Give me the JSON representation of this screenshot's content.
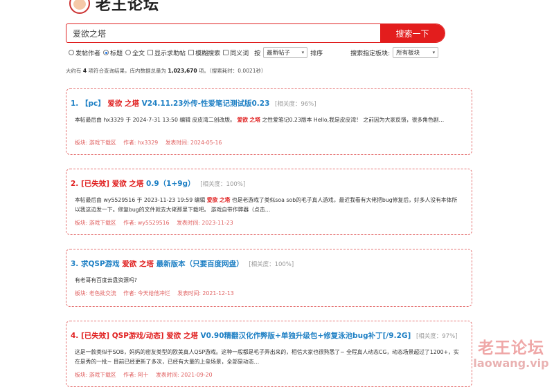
{
  "site": {
    "title": "老王论坛"
  },
  "search": {
    "query": "爱欲之塔",
    "button": "搜索一下"
  },
  "options": {
    "radios": [
      {
        "label": "发帖作者",
        "checked": false
      },
      {
        "label": "标题",
        "checked": true
      },
      {
        "label": "全文",
        "checked": false
      }
    ],
    "checks": [
      {
        "label": "显示求助帖"
      },
      {
        "label": "模糊搜索"
      },
      {
        "label": "同义词"
      }
    ],
    "sort_prefix": "按",
    "sort_value": "最新帖子",
    "sort_suffix": "排序",
    "board_label": "搜索指定板块:",
    "board_value": "所有板块"
  },
  "stats": {
    "p1": "大约有",
    "count": "4",
    "p2": "项符合查询结果，库内数据总量为",
    "total": "1,023,670",
    "p3": "项。（搜索耗时：0.0021秒）"
  },
  "results": [
    {
      "t1": "1. 【pc】",
      "h1": "爱欲",
      "h2": "之塔",
      "t2": "V24.11.23外传-性爱笔记测试版0.23",
      "rel": "[相关度：96%]",
      "d1": "本帖最后由 hx3329 于 2024-7-31 13:50 编辑 皮皮湾二创改版。",
      "dh1": "爱欲",
      "dh2": "之塔",
      "d2": "之性爱笔记0.23版本 Hello,我是皮皮湾！ 之前因为大家反馈，很多角色剧…",
      "board": "板块: 游戏下载区",
      "author": "作者: hx3329",
      "time": "发表时间: 2024-05-16"
    },
    {
      "t1": "2. [已失效]",
      "h1": "爱欲",
      "h2": "之塔",
      "t2": "0.9（1+9g）",
      "rel": "[相关度：100%]",
      "d1": "本帖最后由 wy5529516 于 2023-11-23 19:59 编辑",
      "dh1": "爱欲",
      "dh2": "之塔",
      "d2": "也是老游戏了类似soa sob的毛子真人游戏，最近我看有大佬把bug修复后，好多人没有本体所以我这边发一下。修复bug的文件就去大佬那里下载吧。 游戏自带作弊器（点击…",
      "board": "板块: 游戏下载区",
      "author": "作者: wy5529516",
      "time": "发表时间: 2023-11-23"
    },
    {
      "t1": "3. 求QSP游戏",
      "h1": "爱欲",
      "h2": "之塔",
      "t2": "最新版本（只要百度网盘）",
      "rel": "[相关度：100%]",
      "d1": "有老哥有百度云盘资源吗?",
      "dh1": "",
      "dh2": "",
      "d2": "",
      "board": "板块: 老色批交流",
      "author": "作者: 今天给他冲烂",
      "time": "发表时间: 2021-12-13"
    },
    {
      "t1": "4. [已失效] QSP游戏/动态]",
      "h1": "爱欲",
      "h2": "之塔",
      "t2": "V0.90精翻汉化作弊版+单独升级包+修复泳池bug补丁[/9.2G]",
      "rel": "[相关度：97%]",
      "d1": "这是一款类似于SOB，妈妈的密友类型的欧美真人QSP游戏。这种一般都是毛子弄出来的，相信大家也很熟悉了~ 全程真人动态CG，动态场景超过了1200+，实在是秀的一批~ 目前已经更新了多次，已经有大量的上垒场景，全部是动态…",
      "dh1": "",
      "dh2": "",
      "d2": "",
      "board": "板块: 游戏下载区",
      "author": "作者: 阿十",
      "time": "发表时间: 2021-09-20"
    }
  ],
  "watermark": {
    "line1": "老王论坛",
    "line2": "laowang.vip"
  }
}
